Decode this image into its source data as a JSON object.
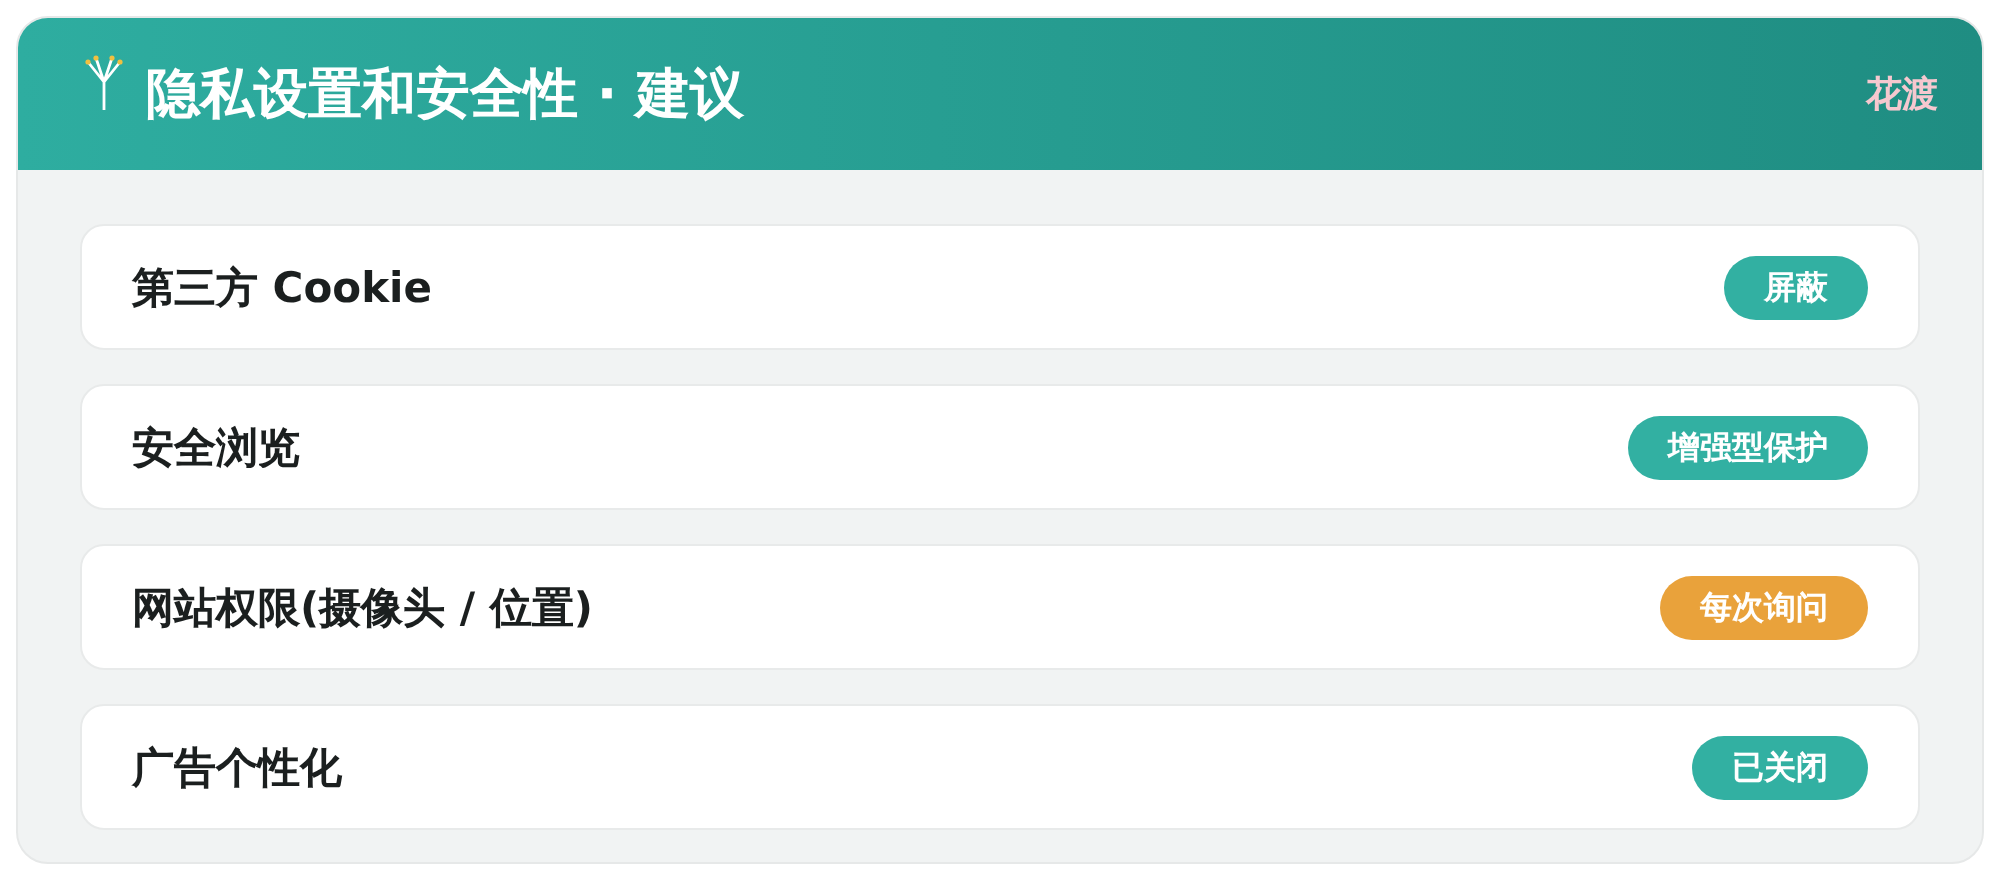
{
  "header": {
    "title": "隐私设置和安全性 · 建议",
    "brand": "花渡"
  },
  "settings": [
    {
      "label": "第三方 Cookie",
      "status": "屏蔽",
      "color": "#32b0a2"
    },
    {
      "label": "安全浏览",
      "status": "增强型保护",
      "color": "#32b0a2"
    },
    {
      "label": "网站权限(摄像头 / 位置)",
      "status": "每次询问",
      "color": "#e9a23b"
    },
    {
      "label": "广告个性化",
      "status": "已关闭",
      "color": "#32b0a2"
    }
  ]
}
